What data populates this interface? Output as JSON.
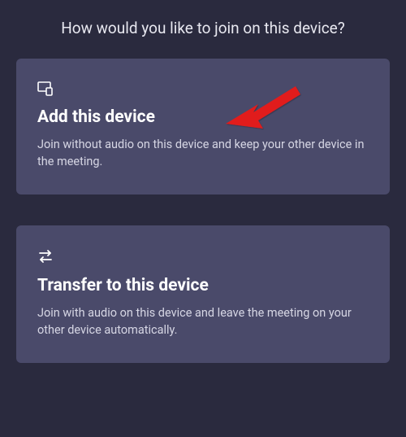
{
  "heading": "How would you like to join on this device?",
  "options": [
    {
      "title": "Add this device",
      "description": "Join without audio on this device and keep your other device in the meeting."
    },
    {
      "title": "Transfer to this device",
      "description": "Join with audio on this device and leave the meeting on your other device automatically."
    }
  ]
}
